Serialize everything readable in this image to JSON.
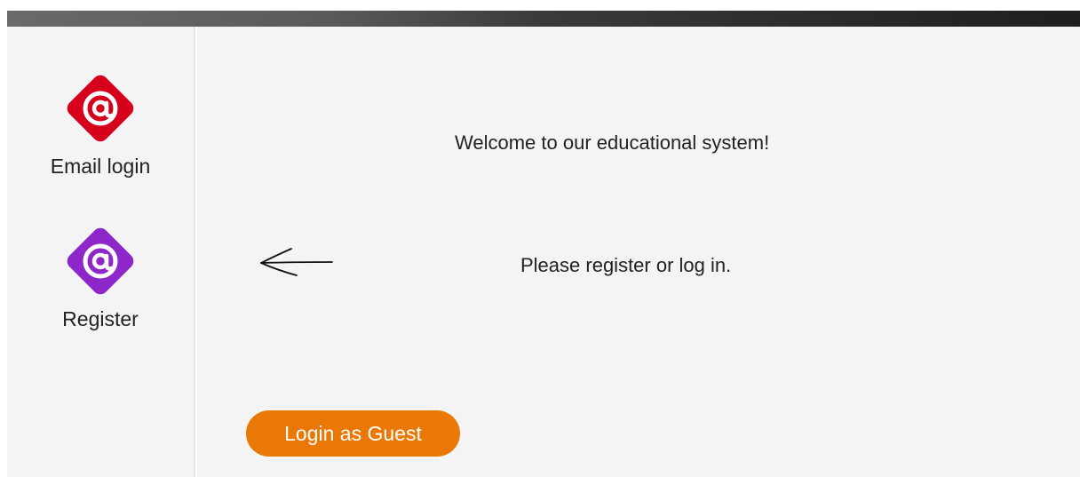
{
  "top_bar": {},
  "sidebar": {
    "items": [
      {
        "label": "Email login",
        "icon": "at-sign-icon",
        "color": "#d6001c"
      },
      {
        "label": "Register",
        "icon": "at-sign-icon",
        "color": "#8e27c9"
      }
    ]
  },
  "main": {
    "welcome_text": "Welcome to our educational system!",
    "prompt_text": "Please register or log in.",
    "arrow_icon": "left-arrow-icon",
    "guest_button_label": "Login as Guest",
    "guest_button_color": "#ea7806"
  }
}
